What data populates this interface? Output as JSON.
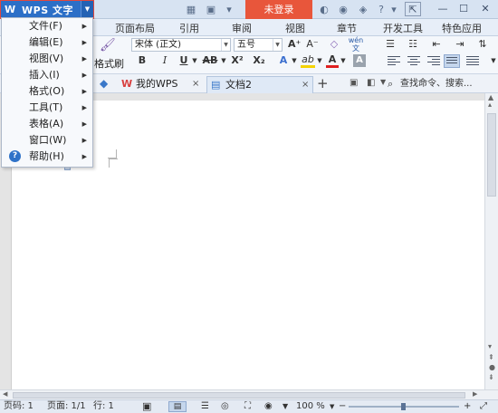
{
  "app": {
    "logo": "W",
    "name": "WPS 文字"
  },
  "titlebar": {
    "login": "未登录",
    "help": "?"
  },
  "ribbon_tabs": [
    "页面布局",
    "引用",
    "审阅",
    "视图",
    "章节",
    "开发工具",
    "特色应用"
  ],
  "ribbon": {
    "format_painter": "格式刷",
    "font_name": "宋体 (正文)",
    "font_size": "五号",
    "wen_label": "wén\n文",
    "bold": "B",
    "italic": "I",
    "underline": "U",
    "strike": "AB",
    "superscript": "X²",
    "subscript": "X₂",
    "text_effect": "A",
    "highlight": "ab",
    "font_color": "A",
    "char_shading": "A"
  },
  "doc_tabs": {
    "tabs": [
      {
        "label": "我的WPS"
      },
      {
        "label": "文档2"
      }
    ],
    "search": "查找命令、搜索..."
  },
  "menu": {
    "items": [
      {
        "label": "文件(F)"
      },
      {
        "label": "编辑(E)"
      },
      {
        "label": "视图(V)"
      },
      {
        "label": "插入(I)"
      },
      {
        "label": "格式(O)"
      },
      {
        "label": "工具(T)"
      },
      {
        "label": "表格(A)"
      },
      {
        "label": "窗口(W)"
      },
      {
        "label": "帮助(H)"
      }
    ]
  },
  "status": {
    "page_code": "页码: 1",
    "page": "页面: 1/1",
    "row": "行: 1",
    "zoom": "100 %"
  },
  "colors": {
    "app_button": "#2c6fc7",
    "login_button": "#e8563b",
    "highlight_yellow": "#f5d300",
    "font_color_red": "#e02020"
  }
}
